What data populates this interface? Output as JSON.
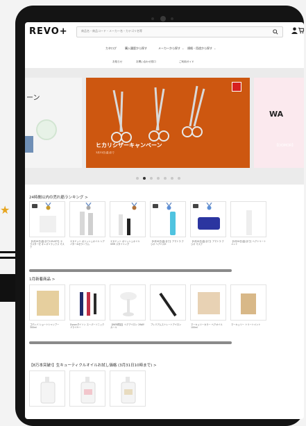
{
  "header": {
    "logo": "REVO+",
    "search_placeholder": "商品名・商品コード・メーカー名・カテゴリ名等",
    "user_icon": "user-icon",
    "cart_icon": "cart-icon"
  },
  "subnav": {
    "items": [
      "カタログ",
      "購入履歴から探す",
      "メーカーから探す",
      "規格・用途から探す"
    ]
  },
  "notice": {
    "items": [
      "お知らせ",
      "お問い合わせ窓口",
      "ご利用ガイド"
    ]
  },
  "carousel": {
    "left_text": "ーン",
    "main_title": "ヒカリシザーキャンペーン",
    "main_sub": "3月31日(金)まで",
    "right_logo": "WA",
    "right_tag": "【DOMOR】",
    "active_dot": 1,
    "dot_count": 7,
    "colors": {
      "main": "#cd5710",
      "right": "#fbe9ee"
    }
  },
  "sections": [
    {
      "title": "24時間以内の売れ筋ランキング >",
      "items": [
        {
          "medal": "gold",
          "desc": "【5月26日(金)まで10%OFF】ケラスターゼ オレオリラックス マスク"
        },
        {
          "medal": "silver",
          "desc": "エヌドット ポリッシュオイル シアバター&ゼラニウム"
        },
        {
          "medal": "bronze",
          "desc": "エヌドット ポリッシュオイル SMR スタイリング"
        },
        {
          "medal": "blue",
          "desc": "【5月26日(金)まで】アマトラ クゥオ ヘアバスH"
        },
        {
          "medal": "blue",
          "desc": "【5月26日(金)まで】アマトラ クゥオ マスク"
        },
        {
          "medal": "none",
          "desc": "【5月26日(金)まで】ヘアトリートメント"
        }
      ]
    },
    {
      "title": "1月新着商品 >",
      "items": [
        {
          "desc": "ゴディバ ショートシャンプー 300ml"
        },
        {
          "desc": "Dysonダイソン スーパーソニック ドライヤー"
        },
        {
          "desc": "【WEB限定】ヘアアイロン 2WAY カール"
        },
        {
          "desc": "プレミアムストレートアイロン"
        },
        {
          "desc": "マーキュリーカラー ヘアオイル 100ml"
        },
        {
          "desc": "マーキュリー トリートメント"
        }
      ]
    },
    {
      "title": "【8万本突破!】生キューティクルオイルお試し価格 (3月31日10時まで) >",
      "items": [
        {
          "desc": ""
        },
        {
          "desc": ""
        },
        {
          "desc": ""
        }
      ]
    }
  ]
}
